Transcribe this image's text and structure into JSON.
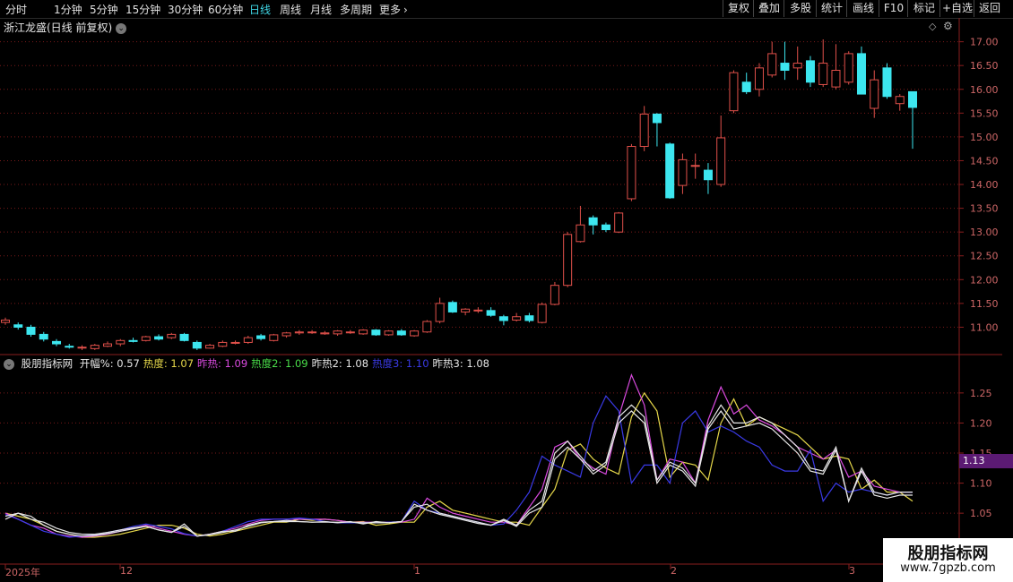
{
  "toolbar": {
    "periods": [
      "分时",
      "1分钟",
      "5分钟",
      "15分钟",
      "30分钟",
      "60分钟",
      "日线",
      "周线",
      "月线",
      "多周期",
      "更多"
    ],
    "active_period": "日线",
    "more_icon": "chevron-right-icon",
    "right_buttons": [
      "复权",
      "叠加",
      "多股",
      "统计",
      "画线",
      "F10",
      "标记",
      "+自选",
      "返回"
    ]
  },
  "main_chart": {
    "title": "浙江龙盛(日线 前复权)",
    "y_labels": [
      "17.00",
      "16.50",
      "16.00",
      "15.50",
      "15.00",
      "14.50",
      "14.00",
      "13.50",
      "13.00",
      "12.50",
      "12.00",
      "11.50",
      "11.00"
    ]
  },
  "indicator": {
    "name": "股朋指标网",
    "values": [
      {
        "label": "开幅%:",
        "value": "0.57",
        "color": "#e6e6e6"
      },
      {
        "label": "热度:",
        "value": "1.07",
        "color": "#e6d84a"
      },
      {
        "label": "昨热:",
        "value": "1.09",
        "color": "#d94adf"
      },
      {
        "label": "热度2:",
        "value": "1.09",
        "color": "#4ade4a"
      },
      {
        "label": "昨热2:",
        "value": "1.08",
        "color": "#e6e6e6"
      },
      {
        "label": "热度3:",
        "value": "1.10",
        "color": "#3a3ae6"
      },
      {
        "label": "昨热3:",
        "value": "1.08",
        "color": "#e6e6e6"
      }
    ],
    "y_labels": [
      "1.25",
      "1.20",
      "1.15",
      "1.10",
      "1.05"
    ],
    "current_tag": "1.13"
  },
  "time_axis": [
    "2025年",
    "12",
    "1",
    "2",
    "3"
  ],
  "watermark": {
    "title": "股朋指标网",
    "url": "www.7gpzb.com"
  },
  "colors": {
    "up": "#e0504a",
    "down": "#3de6ef",
    "grid": "#7a1a1a",
    "axis": "#8a1e1e",
    "label": "#c66"
  },
  "chart_data": {
    "type": "candlestick",
    "ylim": [
      10.5,
      17.2
    ],
    "candles": [
      {
        "o": 11.1,
        "h": 11.2,
        "l": 11.05,
        "c": 11.15
      },
      {
        "o": 11.05,
        "h": 11.1,
        "l": 10.95,
        "c": 11.0
      },
      {
        "o": 11.0,
        "h": 11.05,
        "l": 10.8,
        "c": 10.85
      },
      {
        "o": 10.85,
        "h": 10.9,
        "l": 10.7,
        "c": 10.75
      },
      {
        "o": 10.7,
        "h": 10.75,
        "l": 10.6,
        "c": 10.65
      },
      {
        "o": 10.6,
        "h": 10.65,
        "l": 10.55,
        "c": 10.58
      },
      {
        "o": 10.58,
        "h": 10.62,
        "l": 10.52,
        "c": 10.58
      },
      {
        "o": 10.55,
        "h": 10.65,
        "l": 10.52,
        "c": 10.62
      },
      {
        "o": 10.6,
        "h": 10.7,
        "l": 10.58,
        "c": 10.65
      },
      {
        "o": 10.65,
        "h": 10.75,
        "l": 10.6,
        "c": 10.72
      },
      {
        "o": 10.72,
        "h": 10.78,
        "l": 10.68,
        "c": 10.7
      },
      {
        "o": 10.72,
        "h": 10.82,
        "l": 10.7,
        "c": 10.8
      },
      {
        "o": 10.8,
        "h": 10.85,
        "l": 10.72,
        "c": 10.75
      },
      {
        "o": 10.78,
        "h": 10.88,
        "l": 10.75,
        "c": 10.85
      },
      {
        "o": 10.85,
        "h": 10.88,
        "l": 10.7,
        "c": 10.72
      },
      {
        "o": 10.68,
        "h": 10.72,
        "l": 10.52,
        "c": 10.56
      },
      {
        "o": 10.56,
        "h": 10.65,
        "l": 10.55,
        "c": 10.62
      },
      {
        "o": 10.6,
        "h": 10.72,
        "l": 10.58,
        "c": 10.68
      },
      {
        "o": 10.68,
        "h": 10.72,
        "l": 10.64,
        "c": 10.68
      },
      {
        "o": 10.68,
        "h": 10.82,
        "l": 10.65,
        "c": 10.78
      },
      {
        "o": 10.82,
        "h": 10.86,
        "l": 10.72,
        "c": 10.76
      },
      {
        "o": 10.72,
        "h": 10.86,
        "l": 10.7,
        "c": 10.84
      },
      {
        "o": 10.82,
        "h": 10.9,
        "l": 10.78,
        "c": 10.88
      },
      {
        "o": 10.88,
        "h": 10.94,
        "l": 10.84,
        "c": 10.9
      },
      {
        "o": 10.9,
        "h": 10.94,
        "l": 10.86,
        "c": 10.9
      },
      {
        "o": 10.86,
        "h": 10.92,
        "l": 10.84,
        "c": 10.88
      },
      {
        "o": 10.86,
        "h": 10.94,
        "l": 10.82,
        "c": 10.92
      },
      {
        "o": 10.9,
        "h": 10.94,
        "l": 10.86,
        "c": 10.9
      },
      {
        "o": 10.86,
        "h": 10.96,
        "l": 10.84,
        "c": 10.94
      },
      {
        "o": 10.94,
        "h": 10.96,
        "l": 10.82,
        "c": 10.84
      },
      {
        "o": 10.84,
        "h": 10.94,
        "l": 10.82,
        "c": 10.92
      },
      {
        "o": 10.92,
        "h": 10.96,
        "l": 10.82,
        "c": 10.84
      },
      {
        "o": 10.82,
        "h": 10.94,
        "l": 10.8,
        "c": 10.92
      },
      {
        "o": 10.9,
        "h": 11.15,
        "l": 10.88,
        "c": 11.12
      },
      {
        "o": 11.12,
        "h": 11.62,
        "l": 11.08,
        "c": 11.5
      },
      {
        "o": 11.52,
        "h": 11.56,
        "l": 11.3,
        "c": 11.32
      },
      {
        "o": 11.32,
        "h": 11.4,
        "l": 11.25,
        "c": 11.38
      },
      {
        "o": 11.36,
        "h": 11.42,
        "l": 11.3,
        "c": 11.36
      },
      {
        "o": 11.35,
        "h": 11.42,
        "l": 11.22,
        "c": 11.25
      },
      {
        "o": 11.22,
        "h": 11.26,
        "l": 11.04,
        "c": 11.14
      },
      {
        "o": 11.15,
        "h": 11.3,
        "l": 11.12,
        "c": 11.22
      },
      {
        "o": 11.24,
        "h": 11.3,
        "l": 11.1,
        "c": 11.14
      },
      {
        "o": 11.1,
        "h": 11.52,
        "l": 11.08,
        "c": 11.48
      },
      {
        "o": 11.48,
        "h": 11.95,
        "l": 11.46,
        "c": 11.88
      },
      {
        "o": 11.88,
        "h": 13.0,
        "l": 11.84,
        "c": 12.95
      },
      {
        "o": 12.8,
        "h": 13.55,
        "l": 12.78,
        "c": 13.15
      },
      {
        "o": 13.3,
        "h": 13.35,
        "l": 12.95,
        "c": 13.15
      },
      {
        "o": 13.15,
        "h": 13.2,
        "l": 13.0,
        "c": 13.05
      },
      {
        "o": 13.0,
        "h": 13.42,
        "l": 12.98,
        "c": 13.4
      },
      {
        "o": 13.7,
        "h": 14.85,
        "l": 13.65,
        "c": 14.8
      },
      {
        "o": 14.8,
        "h": 15.65,
        "l": 14.7,
        "c": 15.48
      },
      {
        "o": 15.48,
        "h": 15.5,
        "l": 14.8,
        "c": 15.3
      },
      {
        "o": 14.85,
        "h": 14.88,
        "l": 13.7,
        "c": 13.72
      },
      {
        "o": 13.98,
        "h": 14.65,
        "l": 13.8,
        "c": 14.52
      },
      {
        "o": 14.4,
        "h": 14.65,
        "l": 14.12,
        "c": 14.4
      },
      {
        "o": 14.3,
        "h": 14.45,
        "l": 13.8,
        "c": 14.1
      },
      {
        "o": 14.0,
        "h": 15.45,
        "l": 13.95,
        "c": 14.98
      },
      {
        "o": 15.55,
        "h": 16.4,
        "l": 15.5,
        "c": 16.35
      },
      {
        "o": 16.15,
        "h": 16.35,
        "l": 15.9,
        "c": 15.95
      },
      {
        "o": 16.0,
        "h": 16.55,
        "l": 15.85,
        "c": 16.45
      },
      {
        "o": 16.3,
        "h": 17.0,
        "l": 16.25,
        "c": 16.75
      },
      {
        "o": 16.55,
        "h": 17.0,
        "l": 16.2,
        "c": 16.4
      },
      {
        "o": 16.45,
        "h": 16.9,
        "l": 16.2,
        "c": 16.55
      },
      {
        "o": 16.6,
        "h": 16.7,
        "l": 16.05,
        "c": 16.15
      },
      {
        "o": 16.1,
        "h": 17.05,
        "l": 16.05,
        "c": 16.55
      },
      {
        "o": 16.05,
        "h": 16.95,
        "l": 16.0,
        "c": 16.4
      },
      {
        "o": 16.15,
        "h": 16.8,
        "l": 16.1,
        "c": 16.75
      },
      {
        "o": 16.75,
        "h": 16.9,
        "l": 15.9,
        "c": 15.9
      },
      {
        "o": 15.6,
        "h": 16.4,
        "l": 15.4,
        "c": 16.2
      },
      {
        "o": 16.45,
        "h": 16.55,
        "l": 15.8,
        "c": 15.85
      },
      {
        "o": 15.7,
        "h": 15.9,
        "l": 15.55,
        "c": 15.85
      },
      {
        "o": 15.95,
        "h": 15.95,
        "l": 14.75,
        "c": 15.62
      }
    ],
    "indicator_ylim": [
      1.01,
      1.29
    ],
    "series": [
      {
        "name": "热度",
        "color": "#e6d84a",
        "values": [
          1.05,
          1.045,
          1.04,
          1.03,
          1.02,
          1.015,
          1.01,
          1.01,
          1.012,
          1.015,
          1.02,
          1.025,
          1.03,
          1.03,
          1.025,
          1.015,
          1.012,
          1.015,
          1.02,
          1.025,
          1.03,
          1.035,
          1.035,
          1.04,
          1.038,
          1.04,
          1.038,
          1.035,
          1.036,
          1.03,
          1.032,
          1.035,
          1.035,
          1.06,
          1.07,
          1.055,
          1.05,
          1.045,
          1.04,
          1.035,
          1.035,
          1.03,
          1.06,
          1.09,
          1.155,
          1.165,
          1.14,
          1.125,
          1.115,
          1.21,
          1.25,
          1.22,
          1.11,
          1.135,
          1.13,
          1.105,
          1.2,
          1.24,
          1.195,
          1.21,
          1.2,
          1.19,
          1.18,
          1.16,
          1.14,
          1.145,
          1.14,
          1.09,
          1.105,
          1.085,
          1.085,
          1.07
        ]
      },
      {
        "name": "昨热",
        "color": "#d94adf",
        "values": [
          1.05,
          1.04,
          1.03,
          1.025,
          1.015,
          1.012,
          1.01,
          1.012,
          1.015,
          1.02,
          1.025,
          1.03,
          1.025,
          1.02,
          1.015,
          1.012,
          1.015,
          1.02,
          1.025,
          1.032,
          1.038,
          1.04,
          1.04,
          1.04,
          1.04,
          1.04,
          1.038,
          1.035,
          1.035,
          1.035,
          1.035,
          1.035,
          1.04,
          1.075,
          1.06,
          1.05,
          1.045,
          1.04,
          1.035,
          1.035,
          1.03,
          1.06,
          1.09,
          1.16,
          1.17,
          1.14,
          1.125,
          1.115,
          1.21,
          1.28,
          1.23,
          1.105,
          1.14,
          1.135,
          1.1,
          1.205,
          1.26,
          1.215,
          1.23,
          1.205,
          1.195,
          1.18,
          1.16,
          1.15,
          1.14,
          1.155,
          1.11,
          1.12,
          1.095,
          1.09,
          1.085,
          1.085
        ]
      },
      {
        "name": "热度3",
        "color": "#3a3ae6",
        "values": [
          1.048,
          1.04,
          1.03,
          1.02,
          1.015,
          1.01,
          1.012,
          1.014,
          1.018,
          1.022,
          1.028,
          1.032,
          1.028,
          1.024,
          1.016,
          1.012,
          1.014,
          1.02,
          1.028,
          1.036,
          1.04,
          1.04,
          1.04,
          1.042,
          1.04,
          1.036,
          1.034,
          1.034,
          1.034,
          1.034,
          1.035,
          1.036,
          1.07,
          1.055,
          1.05,
          1.045,
          1.04,
          1.035,
          1.03,
          1.032,
          1.055,
          1.085,
          1.145,
          1.13,
          1.12,
          1.11,
          1.2,
          1.245,
          1.22,
          1.1,
          1.13,
          1.13,
          1.1,
          1.2,
          1.22,
          1.185,
          1.195,
          1.185,
          1.17,
          1.16,
          1.13,
          1.12,
          1.12,
          1.155,
          1.07,
          1.1,
          1.085,
          1.09,
          1.085,
          1.08,
          1.085,
          1.085
        ]
      },
      {
        "name": "昨热2",
        "color": "#e6e6e6",
        "values": [
          1.04,
          1.05,
          1.04,
          1.035,
          1.025,
          1.018,
          1.015,
          1.015,
          1.018,
          1.022,
          1.026,
          1.028,
          1.022,
          1.018,
          1.032,
          1.012,
          1.015,
          1.02,
          1.02,
          1.03,
          1.035,
          1.036,
          1.038,
          1.036,
          1.035,
          1.036,
          1.034,
          1.036,
          1.032,
          1.036,
          1.034,
          1.036,
          1.06,
          1.065,
          1.05,
          1.045,
          1.04,
          1.035,
          1.03,
          1.04,
          1.03,
          1.055,
          1.07,
          1.15,
          1.17,
          1.145,
          1.12,
          1.135,
          1.21,
          1.23,
          1.21,
          1.105,
          1.135,
          1.125,
          1.1,
          1.195,
          1.23,
          1.2,
          1.2,
          1.21,
          1.2,
          1.18,
          1.16,
          1.125,
          1.12,
          1.16,
          1.07,
          1.125,
          1.085,
          1.08,
          1.085,
          1.085
        ]
      },
      {
        "name": "昨热3",
        "color": "#e6e6e6",
        "values": [
          1.045,
          1.05,
          1.045,
          1.03,
          1.02,
          1.015,
          1.012,
          1.013,
          1.016,
          1.02,
          1.024,
          1.028,
          1.022,
          1.018,
          1.028,
          1.012,
          1.014,
          1.018,
          1.022,
          1.028,
          1.034,
          1.036,
          1.036,
          1.036,
          1.035,
          1.035,
          1.035,
          1.035,
          1.034,
          1.034,
          1.034,
          1.036,
          1.065,
          1.055,
          1.048,
          1.043,
          1.038,
          1.033,
          1.03,
          1.038,
          1.028,
          1.05,
          1.06,
          1.14,
          1.16,
          1.14,
          1.115,
          1.13,
          1.2,
          1.22,
          1.2,
          1.1,
          1.13,
          1.12,
          1.095,
          1.19,
          1.22,
          1.19,
          1.195,
          1.2,
          1.19,
          1.17,
          1.15,
          1.12,
          1.115,
          1.155,
          1.07,
          1.12,
          1.08,
          1.075,
          1.08,
          1.08
        ]
      }
    ]
  }
}
